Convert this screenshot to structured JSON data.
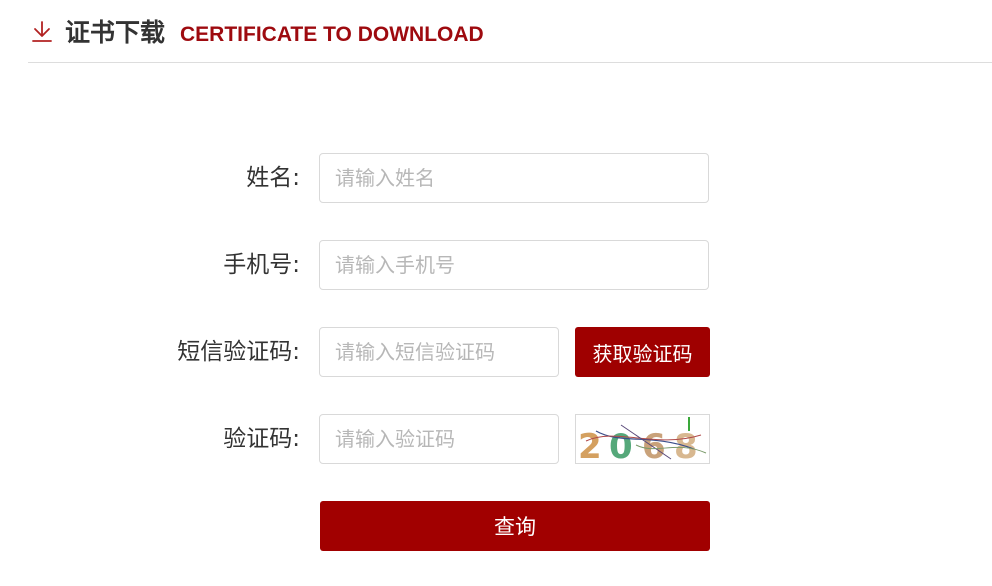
{
  "header": {
    "icon": "download-icon",
    "title_cn": "证书下载",
    "title_en": "CERTIFICATE TO DOWNLOAD",
    "accent_color": "#9e0a0f"
  },
  "form": {
    "name": {
      "label": "姓名:",
      "placeholder": "请输入姓名"
    },
    "phone": {
      "label": "手机号:",
      "placeholder": "请输入手机号"
    },
    "sms_code": {
      "label": "短信验证码:",
      "placeholder": "请输入短信验证码",
      "button": "获取验证码"
    },
    "captcha": {
      "label": "验证码:",
      "placeholder": "请输入验证码",
      "image_text": "2068"
    },
    "submit": "查询",
    "button_color": "#a10000"
  }
}
